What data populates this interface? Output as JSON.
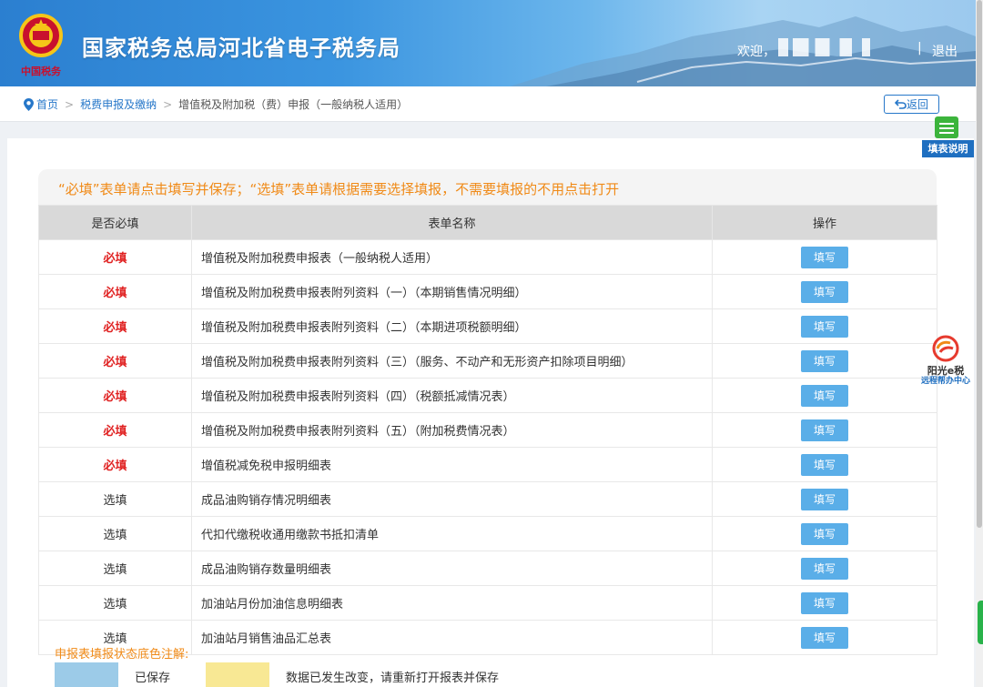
{
  "header": {
    "site_title": "国家税务总局河北省电子税务局",
    "emblem_text": "中国税务",
    "welcome": "欢迎，",
    "separator": "|",
    "logout": "退出"
  },
  "breadcrumb": {
    "home": "首页",
    "level1": "税费申报及缴纳",
    "current": "增值税及附加税（费）申报（一般纳税人适用）",
    "arrow": ">"
  },
  "back_button": "返回",
  "widgets": {
    "fill_help": "填表说明",
    "sunshine_title": "阳光e税",
    "sunshine_sub": "远程帮办中心"
  },
  "notice": "“必填”表单请点击填写并保存；“选填”表单请根据需要选择填报，不需要填报的不用点击打开",
  "table": {
    "headers": [
      "是否必填",
      "表单名称",
      "操作"
    ],
    "button_label": "填写",
    "rows": [
      {
        "required": "必填",
        "must": true,
        "name": "增值税及附加税费申报表（一般纳税人适用）"
      },
      {
        "required": "必填",
        "must": true,
        "name": "增值税及附加税费申报表附列资料（一）（本期销售情况明细）"
      },
      {
        "required": "必填",
        "must": true,
        "name": "增值税及附加税费申报表附列资料（二）（本期进项税额明细）"
      },
      {
        "required": "必填",
        "must": true,
        "name": "增值税及附加税费申报表附列资料（三）（服务、不动产和无形资产扣除项目明细）"
      },
      {
        "required": "必填",
        "must": true,
        "name": "增值税及附加税费申报表附列资料（四）（税额抵减情况表）"
      },
      {
        "required": "必填",
        "must": true,
        "name": "增值税及附加税费申报表附列资料（五）（附加税费情况表）"
      },
      {
        "required": "必填",
        "must": true,
        "name": "增值税减免税申报明细表"
      },
      {
        "required": "选填",
        "must": false,
        "name": "成品油购销存情况明细表"
      },
      {
        "required": "选填",
        "must": false,
        "name": "代扣代缴税收通用缴款书抵扣清单"
      },
      {
        "required": "选填",
        "must": false,
        "name": "成品油购销存数量明细表"
      },
      {
        "required": "选填",
        "must": false,
        "name": "加油站月份加油信息明细表"
      },
      {
        "required": "选填",
        "must": false,
        "name": "加油站月销售油品汇总表"
      }
    ]
  },
  "legend": {
    "title": "申报表填报状态底色注解:",
    "saved": "已保存",
    "changed": "数据已发生改变，请重新打开报表并保存",
    "saved_color": "#9ccbe8",
    "changed_color": "#f8e894"
  }
}
